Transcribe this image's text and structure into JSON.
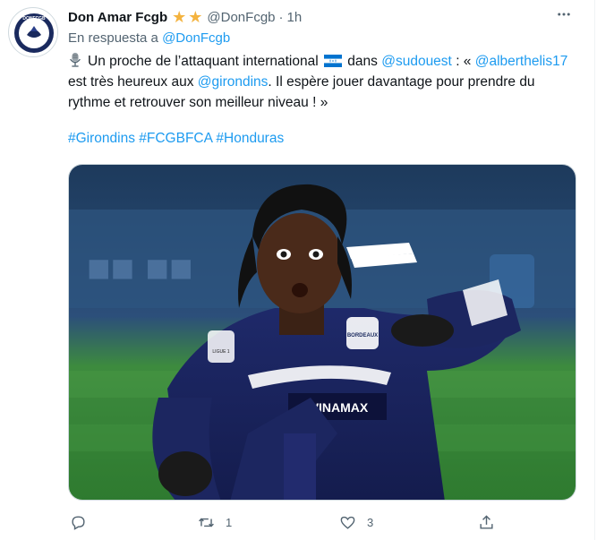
{
  "tweet": {
    "display_name": "Don Amar Fcgb",
    "handle": "@DonFcgb",
    "time": "1h",
    "separator": "·",
    "reply_prefix": "En respuesta a",
    "reply_handle": "@DonFcgb",
    "text_part1": "Un proche de l’attaquant international",
    "text_part2": "dans",
    "mention_sudouest": "@sudouest",
    "text_part3": ": «",
    "mention_albert": "@alberthelis17",
    "text_part4": "est très heureux aux",
    "mention_girondins": "@girondins",
    "text_part5": ". Il espère jouer davantage pour prendre du rythme et retrouver son meilleur niveau ! »",
    "hashtags": "#Girondins #FCGBFCA #Honduras",
    "avatar_text": "DONFCGB",
    "media_description": "Football player in dark blue kit with a shocked expression",
    "media_text_winamax": "WINAMAX",
    "media_text_badge": "BORDEAUX",
    "media_text_ligue": "LIGUE 1"
  },
  "actions": {
    "replies": "",
    "retweets": "1",
    "likes": "3",
    "share": ""
  },
  "colors": {
    "accent": "#1d9bf0",
    "secondary": "#536471",
    "star": "#f4b33f",
    "honduras_blue": "#0073cf"
  },
  "icons": [
    "avatar-logo",
    "star-icon",
    "more-icon",
    "microphone-icon",
    "honduras-flag-icon",
    "reply-icon",
    "retweet-icon",
    "like-icon",
    "share-icon"
  ]
}
